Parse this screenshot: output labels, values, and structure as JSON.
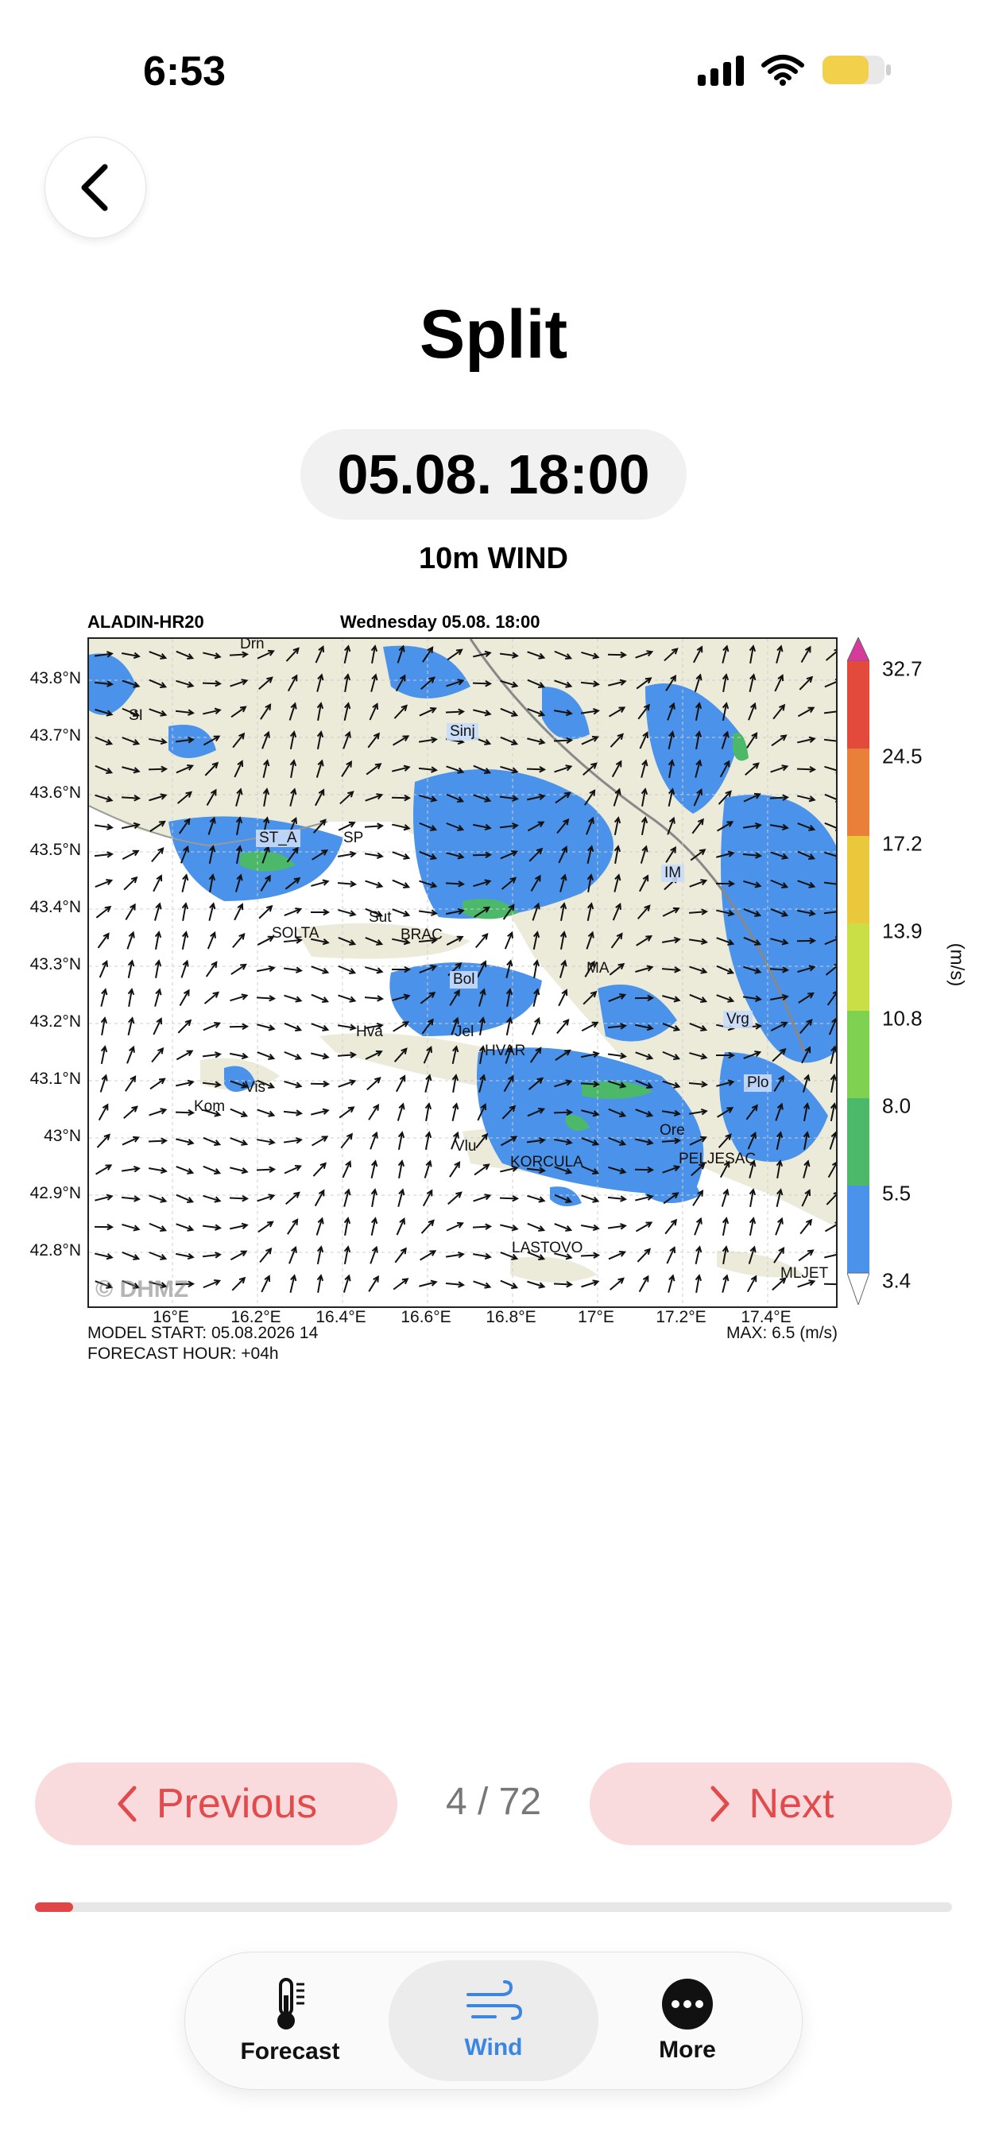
{
  "status": {
    "time": "6:53"
  },
  "header": {
    "city": "Split",
    "datetime": "05.08. 18:00",
    "caption": "10m WIND"
  },
  "map": {
    "model": "ALADIN-HR20",
    "valid": "Wednesday 05.08. 18:00",
    "lat_labels": [
      "43.8°N",
      "43.7°N",
      "43.6°N",
      "43.5°N",
      "43.4°N",
      "43.3°N",
      "43.2°N",
      "43.1°N",
      "43°N",
      "42.9°N",
      "42.8°N"
    ],
    "lon_labels": [
      "16°E",
      "16.2°E",
      "16.4°E",
      "16.6°E",
      "16.8°E",
      "17°E",
      "17.2°E",
      "17.4°E"
    ],
    "colorbar_labels": [
      "32.7",
      "24.5",
      "17.2",
      "13.9",
      "10.8",
      "8.0",
      "5.5",
      "3.4"
    ],
    "colorbar_colors": [
      "#d63a9a",
      "#e34a3c",
      "#e8803a",
      "#e9c83c",
      "#c9df45",
      "#7fd152",
      "#4cb86a",
      "#4a92ea",
      "#ffffff"
    ],
    "unit": "(m/s)",
    "model_start": "MODEL START: 05.08.2026 14",
    "forecast_hour": "FORECAST HOUR: +04h",
    "max": "MAX: 6.5 (m/s)",
    "watermark": "© DHMZ",
    "places": {
      "drn": "Drn",
      "si": "SI",
      "sinj": "Sinj",
      "st_a": "ST_A",
      "sp": "SP",
      "im": "IM",
      "sut": "Sut",
      "solta": "SOLTA",
      "brac": "BRAC",
      "ma": "MA",
      "bol": "Bol",
      "vrg": "Vrg",
      "hva": "Hva",
      "jel": "Jel",
      "hvar": "HVAR",
      "vis": "Vis",
      "kom": "Kom",
      "plo": "Plo",
      "ore": "Ore",
      "vlu": "Vlu",
      "korcula": "KORCULA",
      "peljesac": "PELJESAC",
      "lastovo": "LASTOVO",
      "mljet": "MLJET"
    }
  },
  "pager": {
    "prev_label": "Previous",
    "next_label": "Next",
    "count": "4 / 72",
    "progress": 0.0417
  },
  "tabs": [
    {
      "label": "Forecast",
      "icon": "thermometer-icon"
    },
    {
      "label": "Wind",
      "icon": "wind-icon"
    },
    {
      "label": "More",
      "icon": "more-icon"
    }
  ],
  "colors": {
    "accent": "#3a86e0",
    "danger": "#e14b4b",
    "pill": "#f9dadd"
  }
}
